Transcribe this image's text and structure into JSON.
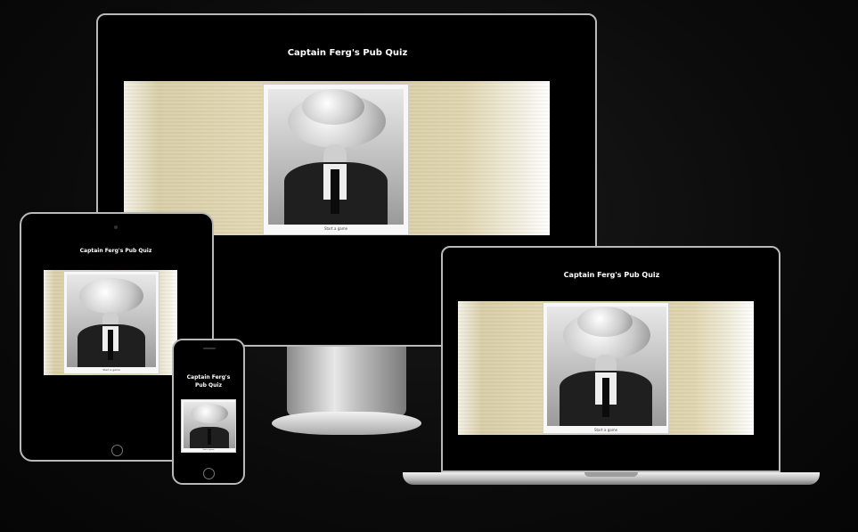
{
  "site": {
    "title": "Captain Ferg's Pub Quiz",
    "start_button_label": "Start a game",
    "hero_image_alt": "mind-blown-man-with-mushroom-cloud-head"
  },
  "devices": [
    "desktop-monitor",
    "tablet",
    "phone",
    "laptop"
  ]
}
